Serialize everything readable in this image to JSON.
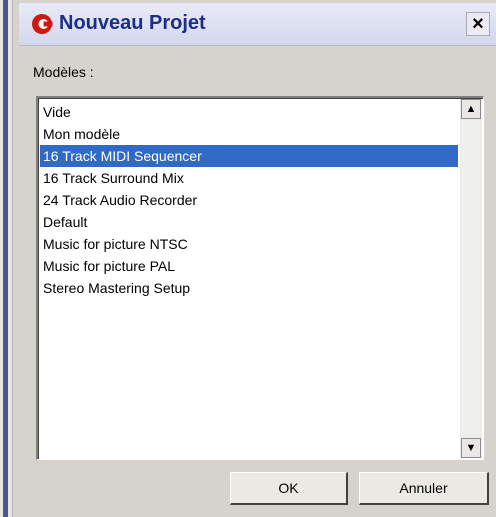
{
  "window": {
    "title": "Nouveau Projet",
    "close_glyph": "×",
    "app_icon": "cubase-logo-icon"
  },
  "models": {
    "label": "Modèles :",
    "items": [
      "Vide",
      "Mon modèle",
      "16 Track MIDI Sequencer",
      "16 Track Surround Mix",
      "24 Track Audio Recorder",
      "Default",
      "Music for picture NTSC",
      "Music for picture PAL",
      "Stereo Mastering Setup"
    ],
    "selected_index": 2,
    "scroll_up_glyph": "▲",
    "scroll_down_glyph": "▼"
  },
  "buttons": {
    "ok_label": "OK",
    "cancel_label": "Annuler"
  },
  "colors": {
    "selection": "#3169c6",
    "title_text": "#1c2d8a",
    "logo_red": "#cc1a12"
  }
}
